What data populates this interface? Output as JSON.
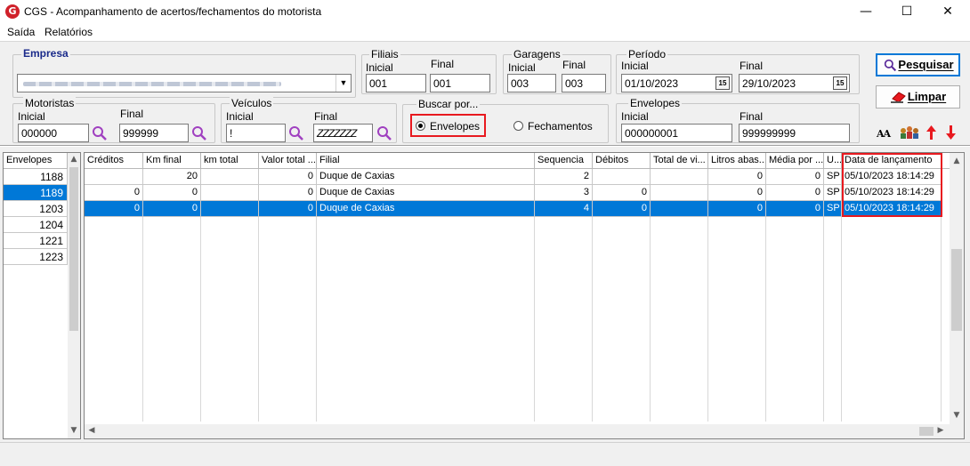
{
  "window": {
    "title": "CGS - Acompanhamento de acertos/fechamentos do motorista",
    "app_icon_letter": "G",
    "minimize": "—",
    "maximize": "☐",
    "close": "✕"
  },
  "menu": {
    "items": [
      "Saída",
      "Relatórios"
    ]
  },
  "filters": {
    "empresa": {
      "label": "Empresa"
    },
    "filiais": {
      "label": "Filiais",
      "inicial_label": "Inicial",
      "final_label": "Final",
      "inicial_value": "001",
      "final_value": "001"
    },
    "garagens": {
      "label": "Garagens",
      "inicial_label": "Inicial",
      "final_label": "Final",
      "inicial_value": "003",
      "final_value": "003"
    },
    "periodo": {
      "label": "Período",
      "inicial_label": "Inicial",
      "final_label": "Final",
      "inicial_value": "01/10/2023",
      "final_value": "29/10/2023",
      "calendar_glyph": "15"
    },
    "motoristas": {
      "label": "Motoristas",
      "inicial_label": "Inicial",
      "final_label": "Final",
      "inicial_value": "000000",
      "final_value": "999999"
    },
    "veiculos": {
      "label": "Veículos",
      "inicial_label": "Inicial",
      "final_label": "Final",
      "inicial_value": "!",
      "final_value": "ZZZZZZZ"
    },
    "buscar_por": {
      "label": "Buscar por...",
      "options": [
        "Envelopes",
        "Fechamentos"
      ],
      "selected": "Envelopes"
    },
    "envelopes": {
      "label": "Envelopes",
      "inicial_label": "Inicial",
      "final_label": "Final",
      "inicial_value": "000000001",
      "final_value": "999999999"
    }
  },
  "actions": {
    "pesquisar": "Pesquisar",
    "limpar": "Limpar",
    "font_icon_text": "AA"
  },
  "envelopes_list": {
    "header": "Envelopes",
    "items": [
      "1188",
      "1189",
      "1203",
      "1204",
      "1221",
      "1223"
    ],
    "selected_index": 1
  },
  "grid": {
    "columns": [
      "Créditos",
      "Km final",
      "km total",
      "Valor total ...",
      "Filial",
      "Sequencia",
      "Débitos",
      "Total de vi...",
      "Litros abas...",
      "Média por ...",
      "U...",
      "Data de lançamento"
    ],
    "rows": [
      [
        "",
        "20",
        "",
        "0",
        "Duque de Caxias",
        "2",
        "",
        "",
        "0",
        "0",
        "SP",
        "05/10/2023 18:14:29"
      ],
      [
        "0",
        "0",
        "",
        "0",
        "Duque de Caxias",
        "3",
        "0",
        "",
        "0",
        "0",
        "SP",
        "05/10/2023 18:14:29"
      ],
      [
        "0",
        "0",
        "",
        "0",
        "Duque de Caxias",
        "4",
        "0",
        "",
        "0",
        "0",
        "SP",
        "05/10/2023 18:14:29"
      ]
    ],
    "selected_row": 2
  },
  "colors": {
    "selection": "#0078d7",
    "highlight_box": "#e8191f",
    "brand_red": "#d0212a",
    "title_blue": "#1a2a8a"
  }
}
